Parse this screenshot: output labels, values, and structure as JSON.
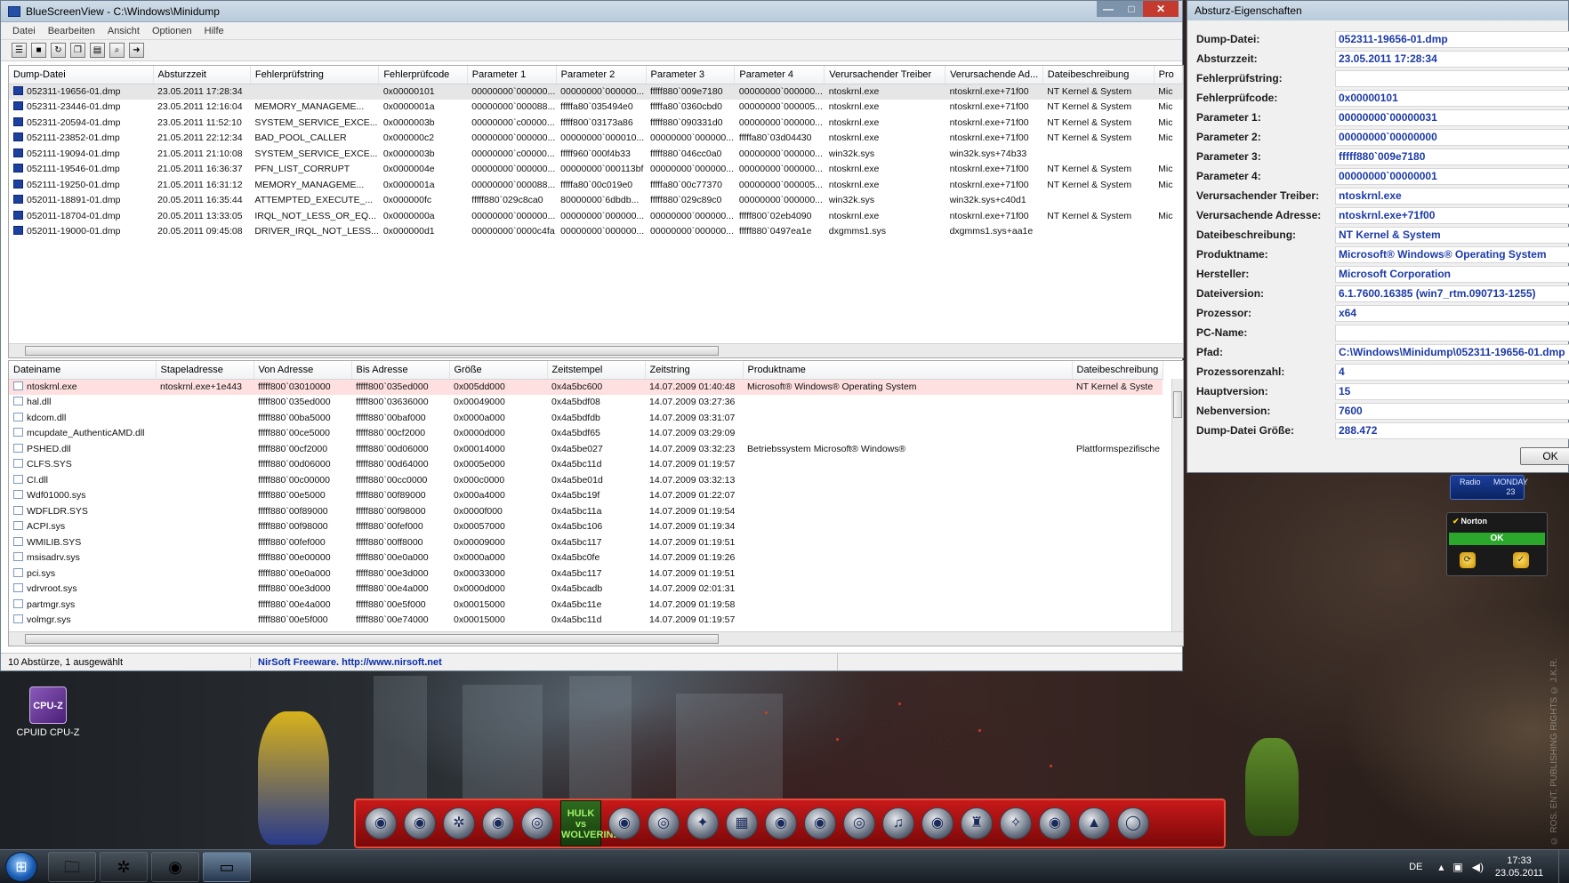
{
  "main_window": {
    "title": "BlueScreenView - C:\\Windows\\Minidump",
    "controls": {
      "minimize": "—",
      "maximize": "□",
      "close": "✕"
    },
    "menu": [
      "Datei",
      "Bearbeiten",
      "Ansicht",
      "Optionen",
      "Hilfe"
    ],
    "toolbar_icons": [
      "properties-icon",
      "save-icon",
      "refresh-icon",
      "copy-icon",
      "html-report-icon",
      "find-icon",
      "exit-icon"
    ],
    "top_grid": {
      "columns": [
        "Dump-Datei",
        "Absturzzeit",
        "Fehlerprüfstring",
        "Fehlerprüfcode",
        "Parameter 1",
        "Parameter 2",
        "Parameter 3",
        "Parameter 4",
        "Verursachender Treiber",
        "Verursachende Ad...",
        "Dateibeschreibung",
        "Pro"
      ],
      "rows": [
        [
          "052311-19656-01.dmp",
          "23.05.2011 17:28:34",
          "",
          "0x00000101",
          "00000000`000000...",
          "00000000`000000...",
          "fffff880`009e7180",
          "00000000`000000...",
          "ntoskrnl.exe",
          "ntoskrnl.exe+71f00",
          "NT Kernel & System",
          "Mic"
        ],
        [
          "052311-23446-01.dmp",
          "23.05.2011 12:16:04",
          "MEMORY_MANAGEME...",
          "0x0000001a",
          "00000000`000088...",
          "fffffa80`035494e0",
          "fffffa80`0360cbd0",
          "00000000`000005...",
          "ntoskrnl.exe",
          "ntoskrnl.exe+71f00",
          "NT Kernel & System",
          "Mic"
        ],
        [
          "052311-20594-01.dmp",
          "23.05.2011 11:52:10",
          "SYSTEM_SERVICE_EXCE...",
          "0x0000003b",
          "00000000`c00000...",
          "fffff800`03173a86",
          "fffff880`090331d0",
          "00000000`000000...",
          "ntoskrnl.exe",
          "ntoskrnl.exe+71f00",
          "NT Kernel & System",
          "Mic"
        ],
        [
          "052111-23852-01.dmp",
          "21.05.2011 22:12:34",
          "BAD_POOL_CALLER",
          "0x000000c2",
          "00000000`000000...",
          "00000000`000010...",
          "00000000`000000...",
          "fffffa80`03d04430",
          "ntoskrnl.exe",
          "ntoskrnl.exe+71f00",
          "NT Kernel & System",
          "Mic"
        ],
        [
          "052111-19094-01.dmp",
          "21.05.2011 21:10:08",
          "SYSTEM_SERVICE_EXCE...",
          "0x0000003b",
          "00000000`c00000...",
          "fffff960`000f4b33",
          "fffff880`046cc0a0",
          "00000000`000000...",
          "win32k.sys",
          "win32k.sys+74b33",
          "",
          ""
        ],
        [
          "052111-19546-01.dmp",
          "21.05.2011 16:36:37",
          "PFN_LIST_CORRUPT",
          "0x0000004e",
          "00000000`000000...",
          "00000000`000113bf",
          "00000000`000000...",
          "00000000`000000...",
          "ntoskrnl.exe",
          "ntoskrnl.exe+71f00",
          "NT Kernel & System",
          "Mic"
        ],
        [
          "052111-19250-01.dmp",
          "21.05.2011 16:31:12",
          "MEMORY_MANAGEME...",
          "0x0000001a",
          "00000000`000088...",
          "fffffa80`00c019e0",
          "fffffa80`00c77370",
          "00000000`000005...",
          "ntoskrnl.exe",
          "ntoskrnl.exe+71f00",
          "NT Kernel & System",
          "Mic"
        ],
        [
          "052011-18891-01.dmp",
          "20.05.2011 16:35:44",
          "ATTEMPTED_EXECUTE_...",
          "0x000000fc",
          "fffff880`029c8ca0",
          "80000000`6dbdb...",
          "fffff880`029c89c0",
          "00000000`000000...",
          "win32k.sys",
          "win32k.sys+c40d1",
          "",
          ""
        ],
        [
          "052011-18704-01.dmp",
          "20.05.2011 13:33:05",
          "IRQL_NOT_LESS_OR_EQ...",
          "0x0000000a",
          "00000000`000000...",
          "00000000`000000...",
          "00000000`000000...",
          "fffff800`02eb4090",
          "ntoskrnl.exe",
          "ntoskrnl.exe+71f00",
          "NT Kernel & System",
          "Mic"
        ],
        [
          "052011-19000-01.dmp",
          "20.05.2011 09:45:08",
          "DRIVER_IRQL_NOT_LESS...",
          "0x000000d1",
          "00000000`0000c4fa",
          "00000000`000000...",
          "00000000`000000...",
          "fffff880`0497ea1e",
          "dxgmms1.sys",
          "dxgmms1.sys+aa1e",
          "",
          ""
        ]
      ]
    },
    "bottom_grid": {
      "columns": [
        "Dateiname",
        "Stapeladresse",
        "Von Adresse",
        "Bis Adresse",
        "Größe",
        "Zeitstempel",
        "Zeitstring",
        "Produktname",
        "Dateibeschreibung"
      ],
      "rows": [
        [
          "ntoskrnl.exe",
          "ntoskrnl.exe+1e443",
          "fffff800`03010000",
          "fffff800`035ed000",
          "0x005dd000",
          "0x4a5bc600",
          "14.07.2009 01:40:48",
          "Microsoft® Windows® Operating System",
          "NT Kernel & Syste"
        ],
        [
          "hal.dll",
          "",
          "fffff800`035ed000",
          "fffff800`03636000",
          "0x00049000",
          "0x4a5bdf08",
          "14.07.2009 03:27:36",
          "",
          ""
        ],
        [
          "kdcom.dll",
          "",
          "fffff880`00ba5000",
          "fffff880`00baf000",
          "0x0000a000",
          "0x4a5bdfdb",
          "14.07.2009 03:31:07",
          "",
          ""
        ],
        [
          "mcupdate_AuthenticAMD.dll",
          "",
          "fffff880`00ce5000",
          "fffff880`00cf2000",
          "0x0000d000",
          "0x4a5bdf65",
          "14.07.2009 03:29:09",
          "",
          ""
        ],
        [
          "PSHED.dll",
          "",
          "fffff880`00cf2000",
          "fffff880`00d06000",
          "0x00014000",
          "0x4a5be027",
          "14.07.2009 03:32:23",
          "Betriebssystem Microsoft® Windows®",
          "Plattformspezifische"
        ],
        [
          "CLFS.SYS",
          "",
          "fffff880`00d06000",
          "fffff880`00d64000",
          "0x0005e000",
          "0x4a5bc11d",
          "14.07.2009 01:19:57",
          "",
          ""
        ],
        [
          "CI.dll",
          "",
          "fffff880`00c00000",
          "fffff880`00cc0000",
          "0x000c0000",
          "0x4a5be01d",
          "14.07.2009 03:32:13",
          "",
          ""
        ],
        [
          "Wdf01000.sys",
          "",
          "fffff880`00e5000",
          "fffff880`00f89000",
          "0x000a4000",
          "0x4a5bc19f",
          "14.07.2009 01:22:07",
          "",
          ""
        ],
        [
          "WDFLDR.SYS",
          "",
          "fffff880`00f89000",
          "fffff880`00f98000",
          "0x0000f000",
          "0x4a5bc11a",
          "14.07.2009 01:19:54",
          "",
          ""
        ],
        [
          "ACPI.sys",
          "",
          "fffff880`00f98000",
          "fffff880`00fef000",
          "0x00057000",
          "0x4a5bc106",
          "14.07.2009 01:19:34",
          "",
          ""
        ],
        [
          "WMILIB.SYS",
          "",
          "fffff880`00fef000",
          "fffff880`00ff8000",
          "0x00009000",
          "0x4a5bc117",
          "14.07.2009 01:19:51",
          "",
          ""
        ],
        [
          "msisadrv.sys",
          "",
          "fffff880`00e00000",
          "fffff880`00e0a000",
          "0x0000a000",
          "0x4a5bc0fe",
          "14.07.2009 01:19:26",
          "",
          ""
        ],
        [
          "pci.sys",
          "",
          "fffff880`00e0a000",
          "fffff880`00e3d000",
          "0x00033000",
          "0x4a5bc117",
          "14.07.2009 01:19:51",
          "",
          ""
        ],
        [
          "vdrvroot.sys",
          "",
          "fffff880`00e3d000",
          "fffff880`00e4a000",
          "0x0000d000",
          "0x4a5bcadb",
          "14.07.2009 02:01:31",
          "",
          ""
        ],
        [
          "partmgr.sys",
          "",
          "fffff880`00e4a000",
          "fffff880`00e5f000",
          "0x00015000",
          "0x4a5bc11e",
          "14.07.2009 01:19:58",
          "",
          ""
        ],
        [
          "volmgr.sys",
          "",
          "fffff880`00e5f000",
          "fffff880`00e74000",
          "0x00015000",
          "0x4a5bc11d",
          "14.07.2009 01:19:57",
          "",
          ""
        ]
      ]
    },
    "status": {
      "count": "10 Abstürze, 1 ausgewählt",
      "link": "NirSoft Freeware.  http://www.nirsoft.net"
    }
  },
  "props": {
    "title": "Absturz-Eigenschaften",
    "rows": [
      {
        "label": "Dump-Datei:",
        "value": "052311-19656-01.dmp"
      },
      {
        "label": "Absturzzeit:",
        "value": "23.05.2011 17:28:34"
      },
      {
        "label": "Fehlerprüfstring:",
        "value": ""
      },
      {
        "label": "Fehlerprüfcode:",
        "value": "0x00000101"
      },
      {
        "label": "Parameter 1:",
        "value": "00000000`00000031"
      },
      {
        "label": "Parameter 2:",
        "value": "00000000`00000000"
      },
      {
        "label": "Parameter 3:",
        "value": "fffff880`009e7180"
      },
      {
        "label": "Parameter 4:",
        "value": "00000000`00000001"
      },
      {
        "label": "Verursachender Treiber:",
        "value": "ntoskrnl.exe"
      },
      {
        "label": "Verursachende Adresse:",
        "value": "ntoskrnl.exe+71f00"
      },
      {
        "label": "Dateibeschreibung:",
        "value": "NT Kernel & System"
      },
      {
        "label": "Produktname:",
        "value": "Microsoft® Windows® Operating System"
      },
      {
        "label": "Hersteller:",
        "value": "Microsoft Corporation"
      },
      {
        "label": "Dateiversion:",
        "value": "6.1.7600.16385 (win7_rtm.090713-1255)"
      },
      {
        "label": "Prozessor:",
        "value": "x64"
      },
      {
        "label": "PC-Name:",
        "value": ""
      },
      {
        "label": "Pfad:",
        "value": "C:\\Windows\\Minidump\\052311-19656-01.dmp"
      },
      {
        "label": "Prozessorenzahl:",
        "value": "4"
      },
      {
        "label": "Hauptversion:",
        "value": "15"
      },
      {
        "label": "Nebenversion:",
        "value": "7600"
      },
      {
        "label": "Dump-Datei Größe:",
        "value": "288.472"
      }
    ],
    "ok_label": "OK"
  },
  "desktop": {
    "cpuz_label": "CPUID CPU-Z",
    "cpuz_badge": "CPU-Z",
    "clock_gadget": {
      "left": "Radio",
      "right_top": "MONDAY",
      "right_bottom": "23"
    },
    "norton_gadget": {
      "title": "Norton",
      "status": "OK"
    },
    "dock_logo_top": "HULK",
    "dock_logo_bottom": "vs WOLVERINE",
    "watermark": "© ROS. ENT. PUBLISHING RIGHTS © J.K.R."
  },
  "taskbar": {
    "lang": "DE",
    "time": "17:33",
    "date": "23.05.2011"
  }
}
